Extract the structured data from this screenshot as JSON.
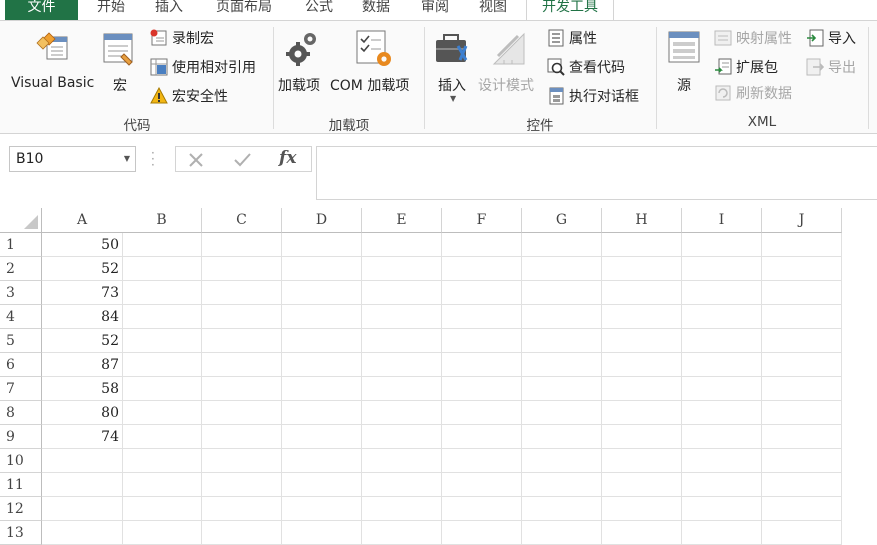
{
  "tabs": {
    "file": "文件",
    "items": [
      {
        "label": "开始"
      },
      {
        "label": "插入"
      },
      {
        "label": "页面布局"
      },
      {
        "label": "公式"
      },
      {
        "label": "数据"
      },
      {
        "label": "审阅"
      },
      {
        "label": "视图"
      }
    ],
    "active": "开发工具"
  },
  "ribbon": {
    "code": {
      "label": "代码",
      "visual_basic": "Visual Basic",
      "macros": "宏",
      "record_macro": "录制宏",
      "relative_refs": "使用相对引用",
      "macro_security": "宏安全性"
    },
    "addins": {
      "label": "加载项",
      "addins": "加载项",
      "com_addins": "COM 加载项"
    },
    "controls": {
      "label": "控件",
      "insert": "插入",
      "design_mode": "设计模式",
      "properties": "属性",
      "view_code": "查看代码",
      "run_dialog": "执行对话框"
    },
    "xml": {
      "label": "XML",
      "source": "源",
      "map_properties": "映射属性",
      "expansion_packs": "扩展包",
      "refresh_data": "刷新数据",
      "import": "导入",
      "export": "导出"
    }
  },
  "formula_bar": {
    "name_box": "B10",
    "formula_value": "",
    "fx_glyph": "fx"
  },
  "sheet": {
    "columns": [
      "A",
      "B",
      "C",
      "D",
      "E",
      "F",
      "G",
      "H",
      "I",
      "J"
    ],
    "rows": [
      "1",
      "2",
      "3",
      "4",
      "5",
      "6",
      "7",
      "8",
      "9",
      "10",
      "11",
      "12",
      "13"
    ],
    "column_a_values": [
      "50",
      "52",
      "73",
      "84",
      "52",
      "87",
      "58",
      "80",
      "74",
      "",
      "",
      "",
      ""
    ]
  },
  "colors": {
    "accent": "#217346",
    "ribbon_bg": "#fafafa",
    "grid_line": "#e1e1e1",
    "disabled_text": "#a6a6a6"
  }
}
